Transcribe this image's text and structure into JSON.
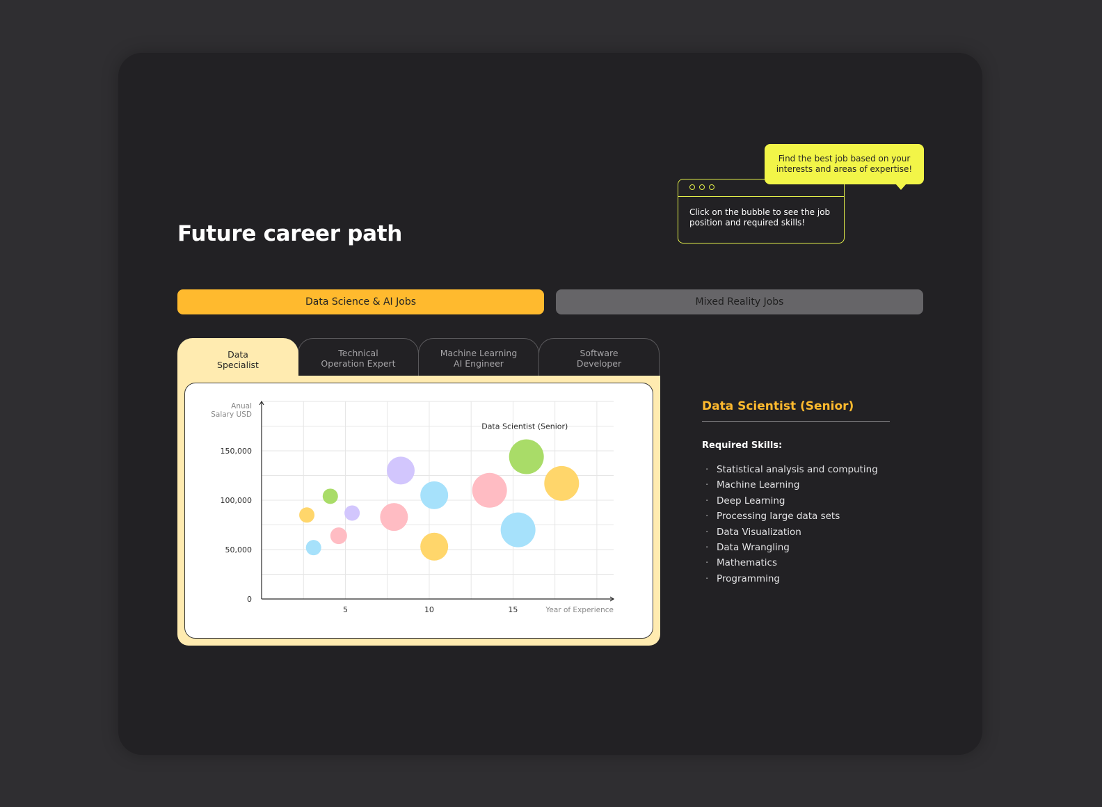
{
  "page": {
    "title": "Future career path"
  },
  "hint": {
    "bubble_text": "Find the best job based on your interests and areas of expertise!",
    "window_text": "Click on the bubble to see the job position and required skills!"
  },
  "category_tabs": [
    {
      "label": "Data Science & AI Jobs",
      "active": true
    },
    {
      "label": "Mixed Reality Jobs",
      "active": false
    }
  ],
  "role_tabs": [
    {
      "label": "Data\nSpecialist",
      "active": true
    },
    {
      "label": "Technical\nOperation Expert",
      "active": false
    },
    {
      "label": "Machine Learning\nAI Engineer",
      "active": false
    },
    {
      "label": "Software\nDeveloper",
      "active": false
    }
  ],
  "colors": {
    "accent": "#ffba2e",
    "hint": "#f2f548",
    "panel": "#ffebb0"
  },
  "chart_data": {
    "type": "scatter",
    "ylabel": "Anual\nSalary USD",
    "xlabel": "Year of Experience",
    "xlim": [
      0,
      21
    ],
    "ylim": [
      0,
      200000
    ],
    "x_ticks": [
      5,
      10,
      15
    ],
    "x_tick_labels": [
      "5",
      "10",
      "15"
    ],
    "y_ticks": [
      0,
      50000,
      100000,
      150000
    ],
    "y_tick_labels": [
      "0",
      "50,000",
      "100,000",
      "150,000"
    ],
    "grid": true,
    "annotation": {
      "text": "Data Scientist (Senior)",
      "x": 15.7,
      "y": 175000
    },
    "points": [
      {
        "x": 2.7,
        "y": 85000,
        "size": 11,
        "color": "#ffd66b"
      },
      {
        "x": 3.1,
        "y": 52000,
        "size": 11,
        "color": "#a6e1fb"
      },
      {
        "x": 4.1,
        "y": 104000,
        "size": 11,
        "color": "#a9dc68"
      },
      {
        "x": 4.6,
        "y": 64000,
        "size": 12,
        "color": "#ffbcc3"
      },
      {
        "x": 5.4,
        "y": 87000,
        "size": 11,
        "color": "#d2c6fd"
      },
      {
        "x": 7.9,
        "y": 83000,
        "size": 20,
        "color": "#ffbcc3"
      },
      {
        "x": 8.3,
        "y": 130000,
        "size": 20,
        "color": "#d2c6fd"
      },
      {
        "x": 10.3,
        "y": 105000,
        "size": 20,
        "color": "#a6e1fb"
      },
      {
        "x": 10.3,
        "y": 53000,
        "size": 20,
        "color": "#ffd66b"
      },
      {
        "x": 13.6,
        "y": 110000,
        "size": 25,
        "color": "#ffbcc3"
      },
      {
        "x": 15.3,
        "y": 70000,
        "size": 25,
        "color": "#a6e1fb"
      },
      {
        "x": 15.8,
        "y": 144000,
        "size": 25,
        "color": "#a9dc68"
      },
      {
        "x": 17.9,
        "y": 117000,
        "size": 25,
        "color": "#ffd66b"
      }
    ]
  },
  "details": {
    "title": "Data Scientist (Senior)",
    "skills_heading": "Required Skills:",
    "skills": [
      "Statistical analysis and computing",
      "Machine Learning",
      "Deep Learning",
      "Processing large data sets",
      "Data Visualization",
      "Data Wrangling",
      "Mathematics",
      "Programming"
    ]
  }
}
